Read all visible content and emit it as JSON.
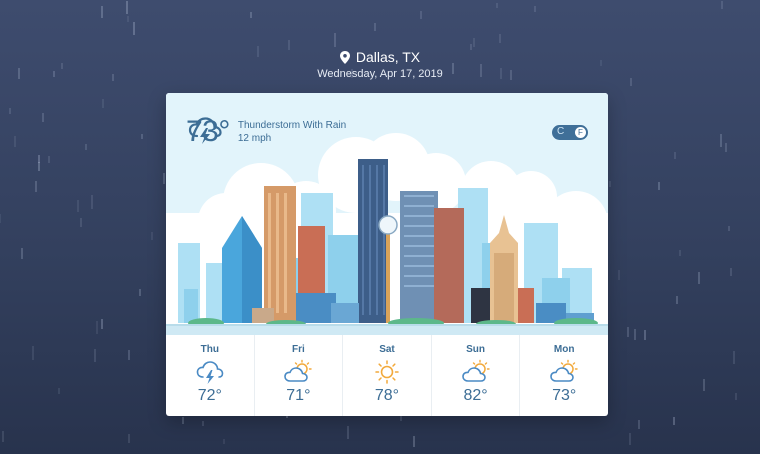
{
  "location": {
    "city": "Dallas, TX",
    "date": "Wednesday, Apr 17, 2019",
    "pin_icon": "map-pin-icon"
  },
  "current": {
    "temperature": "73°",
    "condition": "Thunderstorm With Rain",
    "wind": "12 mph",
    "icon": "thunderstorm-icon"
  },
  "unit_toggle": {
    "celsius_label": "C",
    "fahrenheit_label": "F",
    "selected": "F"
  },
  "forecast": [
    {
      "day": "Thu",
      "temp": "72°",
      "icon": "thunderstorm-icon"
    },
    {
      "day": "Fri",
      "temp": "71°",
      "icon": "partly-cloudy-icon"
    },
    {
      "day": "Sat",
      "temp": "78°",
      "icon": "sun-icon"
    },
    {
      "day": "Sun",
      "temp": "82°",
      "icon": "partly-cloudy-icon"
    },
    {
      "day": "Mon",
      "temp": "73°",
      "icon": "partly-cloudy-icon"
    }
  ],
  "colors": {
    "background": "#3e4c6e",
    "card": "#ffffff",
    "accent": "#3c6d95",
    "icon_stroke": "#4a8ac4",
    "sun": "#f2a93b"
  }
}
